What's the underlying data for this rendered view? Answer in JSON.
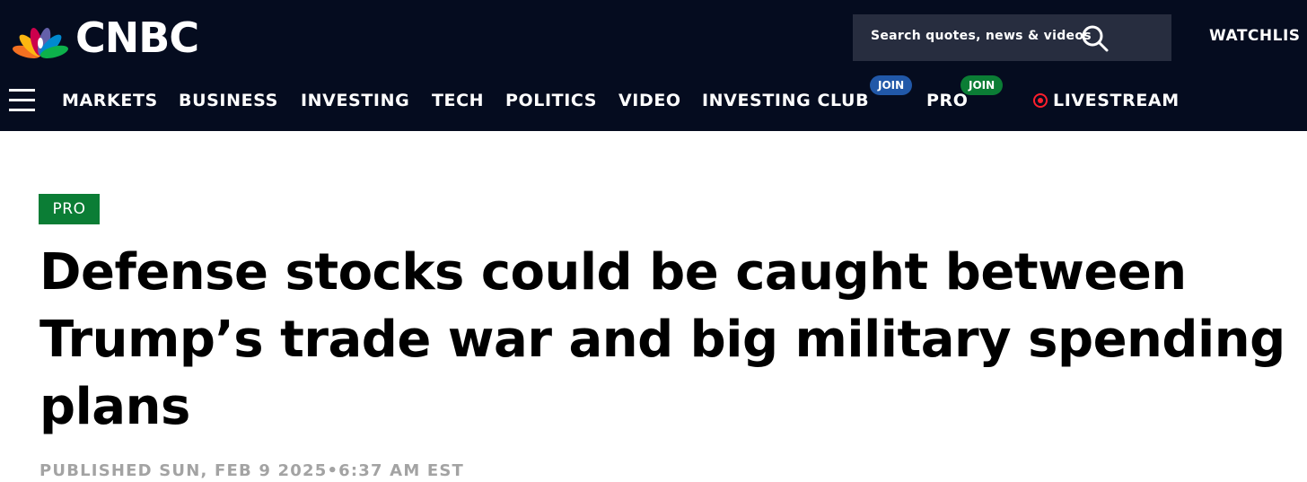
{
  "header": {
    "logo_text": "CNBC",
    "search_placeholder": "Search quotes, news & videos",
    "watchlist_label": "WATCHLIS"
  },
  "nav": {
    "items": [
      {
        "label": "MARKETS"
      },
      {
        "label": "BUSINESS"
      },
      {
        "label": "INVESTING"
      },
      {
        "label": "TECH"
      },
      {
        "label": "POLITICS"
      },
      {
        "label": "VIDEO"
      },
      {
        "label": "INVESTING CLUB",
        "badge": "JOIN"
      },
      {
        "label": "PRO",
        "badge": "JOIN"
      },
      {
        "label": "LIVESTREAM"
      }
    ]
  },
  "article": {
    "badge": "PRO",
    "headline": "Defense stocks could be caught between Trump’s trade war and big military spending plans",
    "published": "PUBLISHED SUN, FEB 9 2025•6:37 AM EST"
  },
  "colors": {
    "header_bg": "#050c1f",
    "search_bg": "#272d3f",
    "pro_green": "#0b7d35",
    "join_blue": "#2158a8",
    "join_green": "#0b7d35",
    "live_red": "#ff1f2d",
    "meta_gray": "#a3a3a3"
  },
  "icons": [
    "peacock-logo-icon",
    "search-icon",
    "menu-icon",
    "live-dot-icon"
  ]
}
